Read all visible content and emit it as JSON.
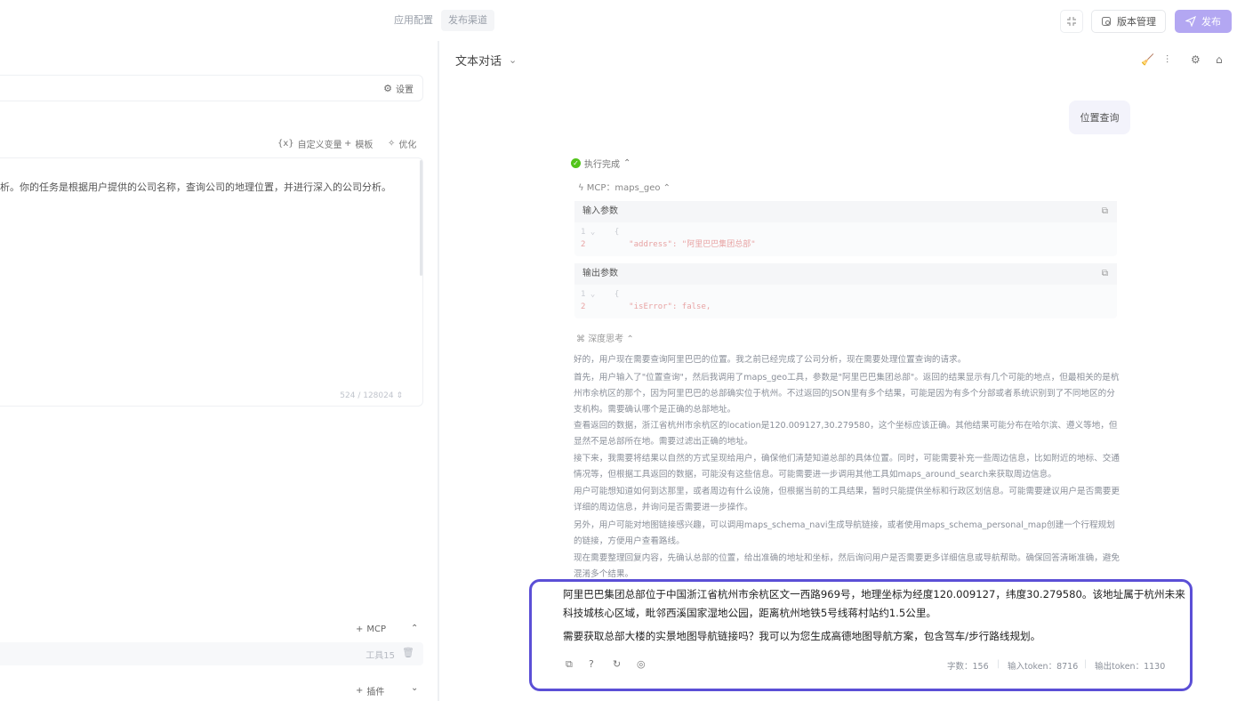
{
  "topbar": {
    "tab_app_config": "应用配置",
    "tab_publish_channel": "发布渠道",
    "version_button": "版本管理",
    "publish_button": "发布"
  },
  "left": {
    "settings_label": "设置",
    "custom_var_label": "自定义变量",
    "template_label": "模板",
    "optimize_label": "优化",
    "prompt_text": "析。你的任务是根据用户提供的公司名称，查询公司的地理位置，并进行深入的公司分析。",
    "char_counter": "524 / 128024",
    "mcp_label": "MCP",
    "tool_count": "工具15",
    "plugin_label": "插件"
  },
  "chat": {
    "mode_label": "文本对话",
    "user_message": "位置查询",
    "exec_status": "执行完成",
    "mcp_call": "MCP：maps_geo",
    "input_params_title": "输入参数",
    "input_code": [
      "1 ⌄    {",
      "2         \"address\": \"阿里巴巴集团总部\""
    ],
    "output_params_title": "输出参数",
    "output_code": [
      "1 ⌄    {",
      "2         \"isError\": false,"
    ],
    "think_title": "深度思考",
    "think_paragraphs": [
      "好的，用户现在需要查询阿里巴巴的位置。我之前已经完成了公司分析，现在需要处理位置查询的请求。",
      "首先，用户输入了\"位置查询\"，然后我调用了maps_geo工具，参数是\"阿里巴巴集团总部\"。返回的结果显示有几个可能的地点，但最相关的是杭州市余杭区的那个，因为阿里巴巴的总部确实位于杭州。不过返回的JSON里有多个结果，可能是因为有多个分部或者系统识别到了不同地区的分支机构。需要确认哪个是正确的总部地址。",
      "查看返回的数据，浙江省杭州市余杭区的location是120.009127,30.279580，这个坐标应该正确。其他结果可能分布在哈尔滨、遵义等地，但显然不是总部所在地。需要过滤出正确的地址。",
      "接下来，我需要将结果以自然的方式呈现给用户，确保他们清楚知道总部的具体位置。同时，可能需要补充一些周边信息，比如附近的地标、交通情况等，但根据工具返回的数据，可能没有这些信息。可能需要进一步调用其他工具如maps_around_search来获取周边信息。",
      "用户可能想知道如何到达那里，或者周边有什么设施，但根据当前的工具结果，暂时只能提供坐标和行政区划信息。可能需要建议用户是否需要更详细的周边信息，并询问是否需要进一步操作。",
      "另外，用户可能对地图链接感兴趣，可以调用maps_schema_navi生成导航链接，或者使用maps_schema_personal_map创建一个行程规划的链接，方便用户查看路线。",
      "现在需要整理回复内容，先确认总部的位置，给出准确的地址和坐标，然后询问用户是否需要更多详细信息或导航帮助。确保回答清晰准确，避免混淆多个结果。"
    ],
    "answer_line1": "阿里巴巴集团总部位于中国浙江省杭州市余杭区文一西路969号，地理坐标为经度120.009127，纬度30.279580。该地址属于杭州未来",
    "answer_line2": "科技城核心区域，毗邻西溪国家湿地公园，距离杭州地铁5号线蒋村站约1.5公里。",
    "answer_line3": "需要获取总部大楼的实景地图导航链接吗？我可以为您生成高德地图导航方案，包含驾车/步行路线规划。",
    "stats": {
      "chars": "字数：156",
      "input_tokens": "输入token：8716",
      "output_tokens": "输出token：1130"
    }
  },
  "colors": {
    "accent": "#5b4fd6",
    "publish_bg": "#b3a7f2",
    "success": "#52c41a"
  }
}
